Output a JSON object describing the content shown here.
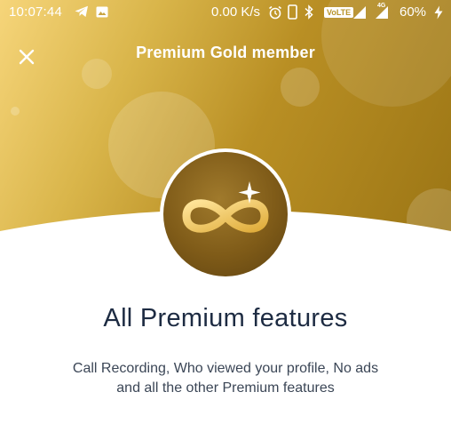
{
  "status_bar": {
    "time": "10:07:44",
    "network_speed": "0.00 K/s",
    "volte_label": "VoLTE",
    "network_type": "4G",
    "battery_percent": "60%",
    "icons": [
      "telegram-icon",
      "gallery-icon",
      "alarm-icon",
      "phone-icon",
      "bluetooth-icon",
      "signal-icon",
      "battery-charging-icon"
    ]
  },
  "header": {
    "title": "Premium Gold member",
    "close_icon": "close-icon"
  },
  "emblem": {
    "icon": "infinity-sparkle-icon"
  },
  "content": {
    "heading": "All Premium features",
    "description_line1": "Call Recording, Who viewed your profile, No ads",
    "description_line2": "and all the other Premium features"
  },
  "colors": {
    "gold_light": "#f6d57a",
    "gold_dark": "#9a7414",
    "emblem_brown": "#7f5b18",
    "heading_text": "#1d2b42",
    "body_text": "#3b4656"
  }
}
